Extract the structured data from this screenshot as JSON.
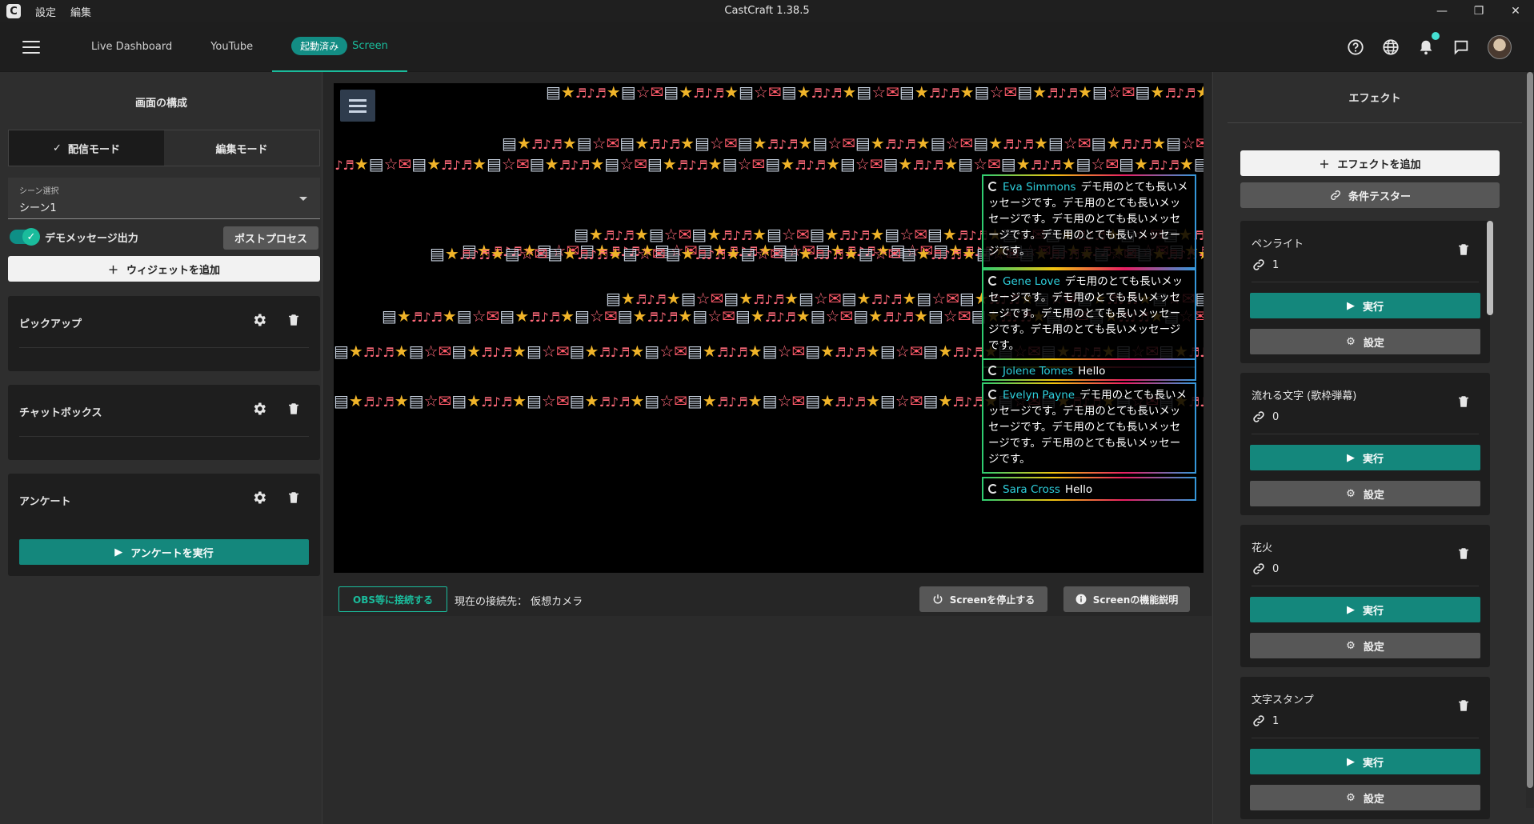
{
  "titlebar": {
    "menu": [
      "設定",
      "編集"
    ],
    "title": "CastCraft 1.38.5",
    "controls": [
      "—",
      "❐",
      "✕"
    ]
  },
  "header": {
    "tabs": [
      "Live Dashboard",
      "YouTube"
    ],
    "screen_tab": {
      "status": "起動済み",
      "label": "Screen"
    },
    "icons": [
      "help-icon",
      "globe-icon",
      "bell-icon",
      "chat-icon",
      "avatar"
    ]
  },
  "left": {
    "title": "画面の構成",
    "mode_tabs": [
      "配信モード",
      "編集モード"
    ],
    "scene_select": {
      "label": "シーン選択",
      "value": "シーン1"
    },
    "demo_label": "デモメッセージ出力",
    "postprocess": "ポストプロセス",
    "add_widget": "ウィジェットを追加",
    "widgets": [
      {
        "name": "ピックアップ"
      },
      {
        "name": "チャットボックス"
      },
      {
        "name": "アンケート",
        "action": "アンケートを実行"
      }
    ]
  },
  "center": {
    "chat": [
      {
        "author": "Eva Simmons",
        "text": "デモ用のとても長いメッセージです。デモ用のとても長いメッセージです。デモ用のとても長いメッセージです。デモ用のとても長いメッセージです。"
      },
      {
        "author": "Gene Love",
        "text": "デモ用のとても長いメッセージです。デモ用のとても長いメッセージです。デモ用のとても長いメッセージです。デモ用のとても長いメッセージです。"
      },
      {
        "author": "Jolene Tomes",
        "text": "Hello"
      },
      {
        "author": "Evelyn Payne",
        "text": "デモ用のとても長いメッセージです。デモ用のとても長いメッセージです。デモ用のとても長いメッセージです。デモ用のとても長いメッセージです。"
      },
      {
        "author": "Sara Cross",
        "text": "Hello"
      }
    ],
    "obs_button": "OBS等に接続する",
    "connection_text": "現在の接続先： 仮想カメラ",
    "stop_button": "Screenを停止する",
    "help_button": "Screenの機能説明"
  },
  "right": {
    "title": "エフェクト",
    "add_effect": "エフェクトを追加",
    "condition_tester": "条件テスター",
    "run_label": "実行",
    "settings_label": "設定",
    "effects": [
      {
        "name": "ペンライト",
        "conditions": "1"
      },
      {
        "name": "流れる文字 (歌枠弾幕)",
        "conditions": "0"
      },
      {
        "name": "花火",
        "conditions": "0"
      },
      {
        "name": "文字スタンプ",
        "conditions": "1"
      }
    ]
  }
}
